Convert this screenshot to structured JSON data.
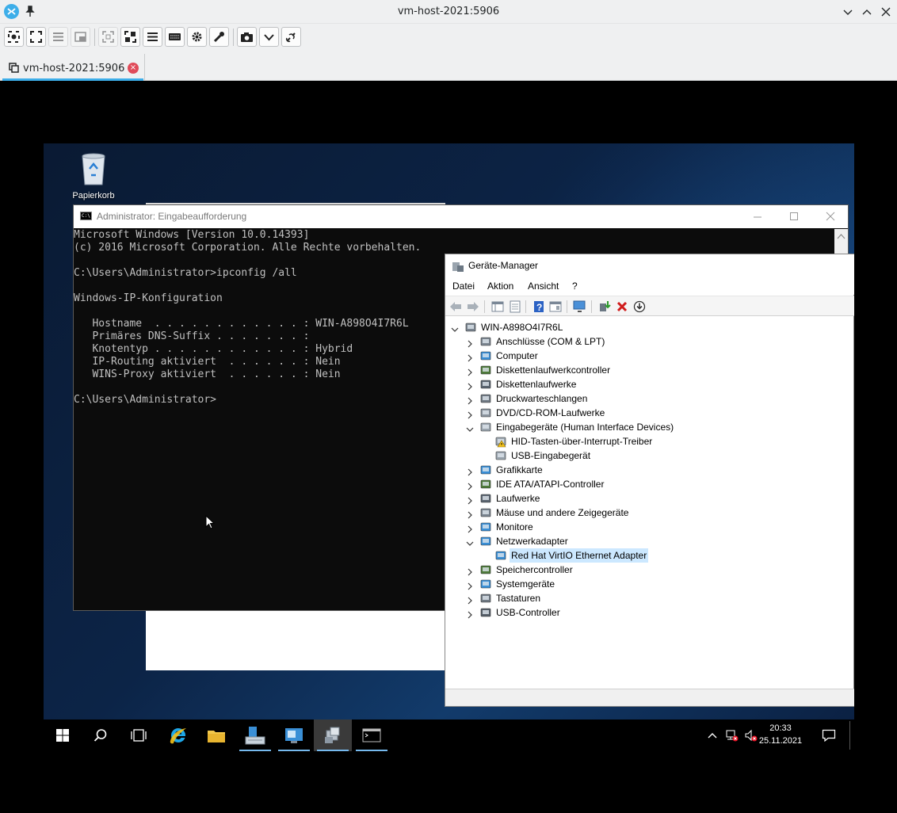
{
  "remmina": {
    "window_title": "vm-host-2021:5906",
    "tab_label": "vm-host-2021:5906",
    "tab_close_glyph": "×",
    "accent": "#3daee9",
    "toolbar_icons": [
      "viewport-fit-icon",
      "fullscreen-icon",
      "menu-icon",
      "window-scale-icon",
      "dynamic-resolution-icon",
      "scale-icon",
      "menu-icon",
      "keyboard-grab-icon",
      "preferences-gear-icon",
      "tools-wrench-icon",
      "screenshot-camera-icon",
      "more-chevron-icon",
      "disconnect-icon"
    ]
  },
  "desktop": {
    "recycle_bin_label": "Papierkorb"
  },
  "cmd": {
    "title": "Administrator: Eingabeaufforderung",
    "lines": [
      "Microsoft Windows [Version 10.0.14393]",
      "(c) 2016 Microsoft Corporation. Alle Rechte vorbehalten.",
      "",
      "C:\\Users\\Administrator>ipconfig /all",
      "",
      "Windows-IP-Konfiguration",
      "",
      "   Hostname  . . . . . . . . . . . . : WIN-A898O4I7R6L",
      "   Primäres DNS-Suffix . . . . . . . :",
      "   Knotentyp . . . . . . . . . . . . : Hybrid",
      "   IP-Routing aktiviert  . . . . . . : Nein",
      "   WINS-Proxy aktiviert  . . . . . . : Nein",
      "",
      "C:\\Users\\Administrator>"
    ]
  },
  "devmgr": {
    "title": "Geräte-Manager",
    "menu": [
      "Datei",
      "Aktion",
      "Ansicht",
      "?"
    ],
    "root": "WIN-A898O4I7R6L",
    "tree": [
      {
        "label": "Anschlüsse (COM & LPT)",
        "icon": "port-icon",
        "expanded": false
      },
      {
        "label": "Computer",
        "icon": "computer-icon",
        "expanded": false
      },
      {
        "label": "Diskettenlaufwerkcontroller",
        "icon": "floppy-controller-icon",
        "expanded": false
      },
      {
        "label": "Diskettenlaufwerke",
        "icon": "floppy-drive-icon",
        "expanded": false
      },
      {
        "label": "Druckwarteschlangen",
        "icon": "printer-icon",
        "expanded": false
      },
      {
        "label": "DVD/CD-ROM-Laufwerke",
        "icon": "dvd-drive-icon",
        "expanded": false
      },
      {
        "label": "Eingabegeräte (Human Interface Devices)",
        "icon": "hid-icon",
        "expanded": true,
        "children": [
          {
            "label": "HID-Tasten-über-Interrupt-Treiber",
            "icon": "hid-warning-icon"
          },
          {
            "label": "USB-Eingabegerät",
            "icon": "hid-device-icon"
          }
        ]
      },
      {
        "label": "Grafikkarte",
        "icon": "display-adapter-icon",
        "expanded": false
      },
      {
        "label": "IDE ATA/ATAPI-Controller",
        "icon": "ide-controller-icon",
        "expanded": false
      },
      {
        "label": "Laufwerke",
        "icon": "disk-drive-icon",
        "expanded": false
      },
      {
        "label": "Mäuse und andere Zeigegeräte",
        "icon": "mouse-icon",
        "expanded": false
      },
      {
        "label": "Monitore",
        "icon": "monitor-icon",
        "expanded": false
      },
      {
        "label": "Netzwerkadapter",
        "icon": "network-adapter-icon",
        "expanded": true,
        "children": [
          {
            "label": "Red Hat VirtIO Ethernet Adapter",
            "icon": "network-card-icon",
            "selected": true
          }
        ]
      },
      {
        "label": "Speichercontroller",
        "icon": "storage-controller-icon",
        "expanded": false
      },
      {
        "label": "Systemgeräte",
        "icon": "system-devices-icon",
        "expanded": false
      },
      {
        "label": "Tastaturen",
        "icon": "keyboard-icon",
        "expanded": false
      },
      {
        "label": "USB-Controller",
        "icon": "usb-icon",
        "expanded": false
      }
    ]
  },
  "taskbar": {
    "time": "20:33",
    "date": "25.11.2021",
    "apps": [
      "start-icon",
      "search-icon",
      "task-view-icon",
      "internet-explorer-icon",
      "file-explorer-icon",
      "server-manager-icon",
      "device-manager-taskbar-icon",
      "remote-app-icon",
      "cmd-taskbar-icon"
    ]
  }
}
